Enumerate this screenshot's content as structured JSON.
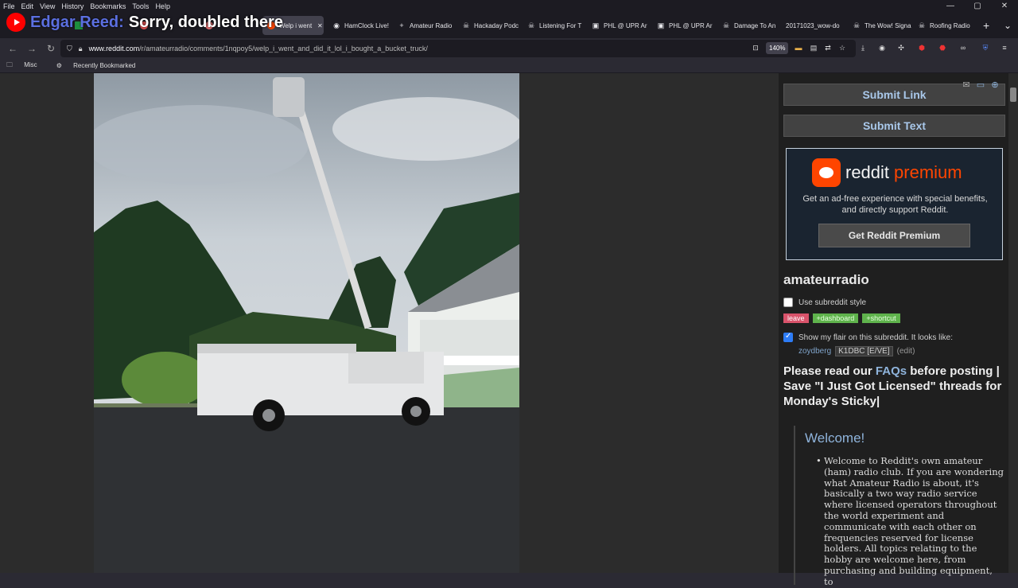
{
  "menu": [
    "File",
    "Edit",
    "View",
    "History",
    "Bookmarks",
    "Tools",
    "Help"
  ],
  "window_controls": [
    "—",
    "▢",
    "✕"
  ],
  "overlay": {
    "name": "Edgar Reed:",
    "message": "Sorry, doubled there"
  },
  "tabs": [
    {
      "label": "HamClock Live!",
      "icon": "hamclock-icon"
    },
    {
      "label": "Amateur Radio",
      "icon": "plus-icon"
    },
    {
      "label": "Hackaday Podc",
      "icon": "hackaday-icon"
    },
    {
      "label": "Listening For T",
      "icon": "hackaday-icon"
    },
    {
      "label": "PHL @ UPR Ar",
      "icon": "page-icon"
    },
    {
      "label": "PHL @ UPR Ar",
      "icon": "page-icon"
    },
    {
      "label": "Damage To An",
      "icon": "hackaday-icon"
    },
    {
      "label": "20171023_wow-do",
      "icon": "none"
    },
    {
      "label": "The Wow! Signa",
      "icon": "hackaday-icon"
    },
    {
      "label": "Roofing Radio",
      "icon": "hackaday-icon"
    }
  ],
  "active_tab": {
    "label": "Welp i went",
    "close": "✕"
  },
  "new_tab": "+",
  "tab_list": "⌄",
  "url": {
    "host": "www.reddit.com",
    "path": "/r/amateurradio/comments/1nqpoy5/welp_i_went_and_did_it_lol_i_bought_a_bucket_truck/"
  },
  "zoom": "140%",
  "bookmarks": [
    {
      "label": "Misc",
      "icon": "folder-icon"
    },
    {
      "label": "Recently Bookmarked",
      "icon": "gear-icon"
    }
  ],
  "sidebar": {
    "submit_link": "Submit Link",
    "submit_text": "Submit Text",
    "premium": {
      "word1": "reddit",
      "word2": "premium",
      "description": "Get an ad-free experience with special benefits, and directly support Reddit.",
      "button": "Get Reddit Premium"
    },
    "subreddit": "amateurradio",
    "use_style_label": "Use subreddit style",
    "leave": "leave",
    "dashboard": "+dashboard",
    "shortcut": "+shortcut",
    "flair_label": "Show my flair on this subreddit. It looks like:",
    "flair_user": "zoydberg",
    "flair_tag": "K1DBC [E/VE]",
    "flair_edit": "(edit)",
    "rules_pre": "Please read our ",
    "rules_link": "FAQs",
    "rules_post": " before posting | Save \"I Just Got Licensed\" threads for Monday's Sticky|",
    "welcome": "Welcome!",
    "welcome_text": "Welcome to Reddit's own amateur (ham) radio club. If you are wondering what Amateur Radio is about, it's basically a two way radio service where licensed operators throughout the world experiment and communicate with each other on frequencies reserved for license holders. All topics relating to the hobby are welcome here, from purchasing and building equipment, to"
  },
  "colors": {
    "accent_link": "#8fb4dc",
    "reddit_orange": "#ff4500",
    "leave": "#d9536b",
    "green_pill": "#5fb34c"
  }
}
